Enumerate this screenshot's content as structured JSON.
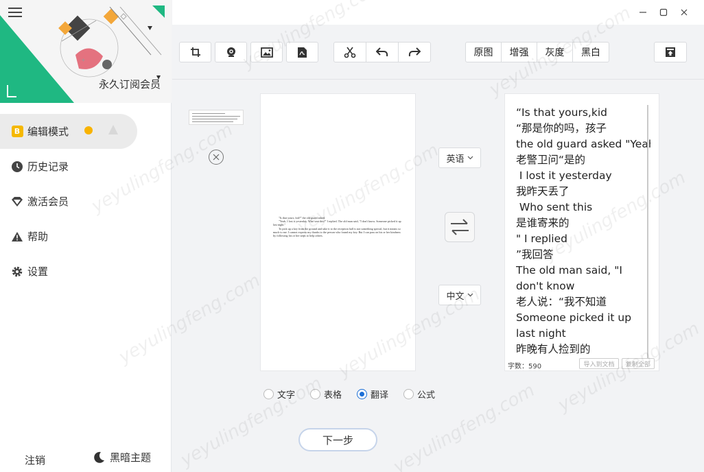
{
  "sidebar": {
    "vip_text": "永久订阅会员",
    "items": [
      {
        "label": "编辑模式",
        "icon": "b-badge-icon",
        "active": true
      },
      {
        "label": "历史记录",
        "icon": "clock-icon",
        "active": false
      },
      {
        "label": "激活会员",
        "icon": "diamond-icon",
        "active": false
      },
      {
        "label": "帮助",
        "icon": "warning-triangle-icon",
        "active": false
      },
      {
        "label": "设置",
        "icon": "gear-icon",
        "active": false
      }
    ],
    "badge_letter": "B",
    "logout": "注销",
    "dark_theme": "黑暗主题"
  },
  "toolbar": {
    "icons": [
      "crop-icon",
      "camera-icon",
      "image-icon",
      "pdf-icon",
      "cut-icon",
      "undo-icon",
      "redo-icon",
      "export-icon"
    ],
    "filters": [
      "原图",
      "增强",
      "灰度",
      "黑白"
    ]
  },
  "document": {
    "paragraphs": [
      "\"Is that yours, kid?\" the old guard asked.",
      "\"Yeah, I lost it yesterday. Who sent this?\" I replied. The old man said, \"I don't know. Someone picked it up last night.\"",
      "To pick up a key from the ground and take it to the reception hall is not something special, but it means so much to me. I cannot express my thanks to the person who found my key. But I can pass on his or her kindness by following his or her steps to help others."
    ]
  },
  "lang": {
    "source": "英语",
    "target": "中文"
  },
  "result": {
    "lines": [
      "“Is that yours,kid",
      "“那是你的吗，孩子",
      "the old guard asked  \"Yeah",
      "老警卫问“是的",
      " I lost it yesterday",
      "我昨天丢了",
      " Who sent this",
      "是谁寄来的",
      "\" I replied",
      "”我回答",
      " The old man said, \"I don't know",
      "老人说：“我不知道",
      " Someone picked it up last night",
      "昨晚有人捡到的"
    ],
    "char_count": "字数：590",
    "import_btn": "导入到文档",
    "copy_btn": "复制全部"
  },
  "modes": {
    "options": [
      "文字",
      "表格",
      "翻译",
      "公式"
    ],
    "selected": "翻译"
  },
  "next_label": "下一步",
  "watermark": "yeyulingfeng.com",
  "colors": {
    "accent_green": "#1fb882",
    "badge_yellow": "#f5b800",
    "radio_blue": "#1c6fd6"
  }
}
